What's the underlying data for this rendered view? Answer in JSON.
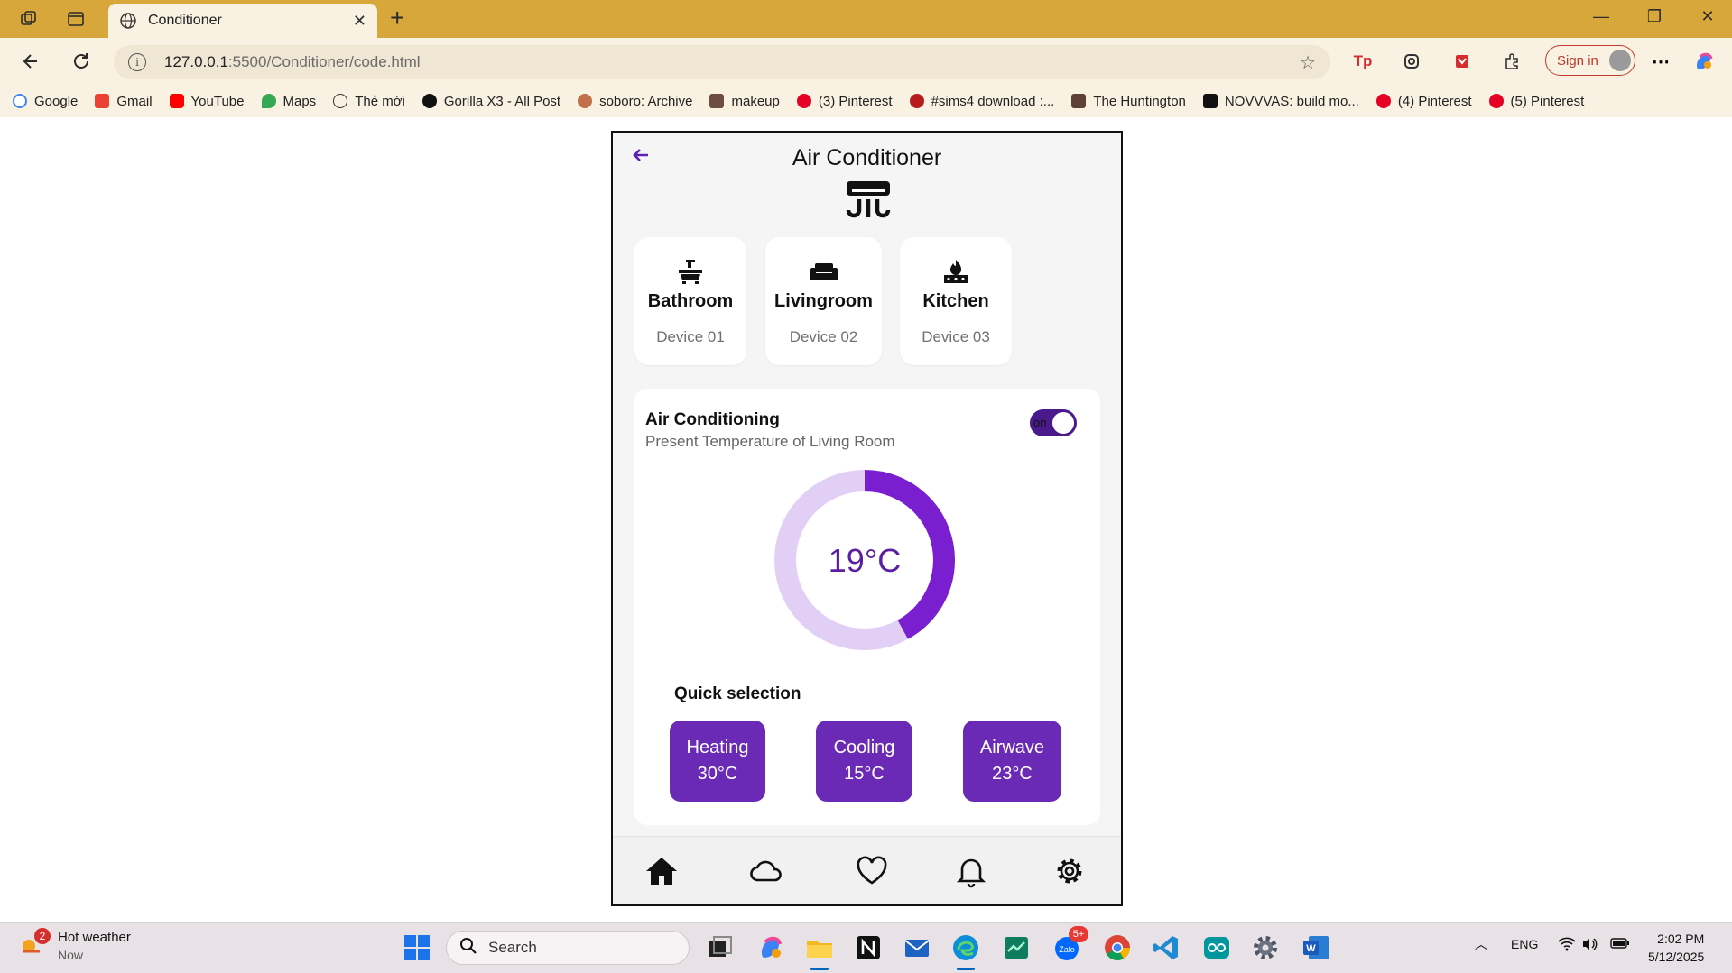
{
  "browser": {
    "tab_title": "Conditioner",
    "url_host": "127.0.0.1",
    "url_rest": ":5500/Conditioner/code.html",
    "signin_label": "Sign in",
    "bookmarks": [
      "Google",
      "Gmail",
      "YouTube",
      "Maps",
      "Thẻ mới",
      "Gorilla X3 - All Post",
      "soboro: Archive",
      "makeup",
      "(3) Pinterest",
      "#sims4 download :...",
      "The Huntington",
      "NOVVVAS: build mo...",
      "(4) Pinterest",
      "(5) Pinterest"
    ]
  },
  "app": {
    "title": "Air Conditioner",
    "rooms": [
      {
        "name": "Bathroom",
        "device": "Device 01"
      },
      {
        "name": "Livingroom",
        "device": "Device 02"
      },
      {
        "name": "Kitchen",
        "device": "Device 03"
      }
    ],
    "panel": {
      "title": "Air Conditioning",
      "subtitle": "Present Temperature of Living Room",
      "toggle_label": "on",
      "temperature": "19°C",
      "gauge_fill_fraction": 0.42
    },
    "quick_selection": {
      "title": "Quick selection",
      "options": [
        {
          "mode": "Heating",
          "temp": "30°C"
        },
        {
          "mode": "Cooling",
          "temp": "15°C"
        },
        {
          "mode": "Airwave",
          "temp": "23°C"
        }
      ]
    },
    "colors": {
      "accent": "#6a2ab6",
      "accent_dark": "#4a1a8a",
      "gauge_track": "#e1cff5",
      "gauge_fill": "#7a1fd0"
    }
  },
  "taskbar": {
    "weather_title": "Hot weather",
    "weather_sub": "Now",
    "weather_badge": "2",
    "search_label": "Search",
    "zalo_badge": "5+",
    "lang": "ENG",
    "time": "2:02 PM",
    "date": "5/12/2025"
  }
}
